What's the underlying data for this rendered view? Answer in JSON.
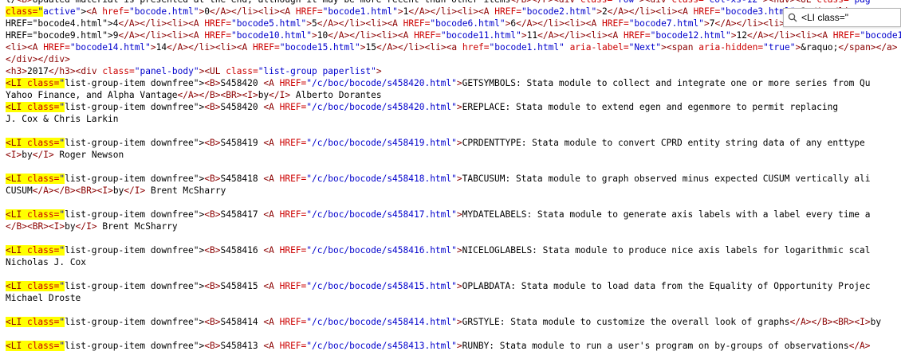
{
  "find_bar": {
    "value": "<LI class=\"",
    "highlight_color": "#ffff00"
  },
  "colors": {
    "tag": "#8b0000",
    "attribute": "#cc0000",
    "value": "#0000cc",
    "highlight": "#ffff00"
  },
  "source_lines": [
    "l/<B>Updated material is presented at the end, although it may be more recent than other items</B></P><div class=\"row\"><div class=\"col-xs-12\"><nav><UL class=\"pag",
    "class=\"active\"><A href=\"bocode.html\">0</A></li><li><A HREF=\"bocode1.html\">1</A></li><li><A HREF=\"bocode2.html\">2</A></li><li><A HREF=\"bocode3.html\">3</A></li>",
    "HREF=\"bocode4.html\">4</A></li><li><A HREF=\"bocode5.html\">5</A></li><li><A HREF=\"bocode6.html\">6</A></li><li><A HREF=\"bocode7.html\">7</A></li><li><A HREF=\"bocode8.html\">8",
    "HREF=\"bocode9.html\">9</A></li><li><A HREF=\"bocode10.html\">10</A></li><li><A HREF=\"bocode11.html\">11</A></li><li><A HREF=\"bocode12.html\">12</A></li><li><A HREF=\"bocode13",
    "<li><A HREF=\"bocode14.html\">14</A></li><li><A HREF=\"bocode15.html\">15</A></li><li><a href=\"bocode1.html\" aria-label=\"Next\"><span aria-hidden=\"true\">&raquo;</span></a>",
    "</div></div>",
    "<h3>2017</h3><div class=\"panel-body\"><UL class=\"list-group paperlist\">",
    "<LI class=\"list-group-item downfree\"><B>S458420 <A HREF=\"/c/boc/bocode/s458420.html\">GETSYMBOLS: Stata module to collect and integrate one or more series from Qu",
    "Yahoo Finance, and Alpha Vantage</A></B><BR><I>by</I> Alberto Dorantes",
    "<LI class=\"list-group-item downfree\"><B>S458420 <A HREF=\"/c/boc/bocode/s458420.html\">EREPLACE: Stata module to extend egen and egenmore to permit replacing",
    "J. Cox & Chris Larkin",
    "",
    "<LI class=\"list-group-item downfree\"><B>S458419 <A HREF=\"/c/boc/bocode/s458419.html\">CPRDENTTYPE: Stata module to convert CPRD entity string data of any enttype",
    "<I>by</I> Roger Newson",
    "",
    "<LI class=\"list-group-item downfree\"><B>S458418 <A HREF=\"/c/boc/bocode/s458418.html\">TABCUSUM: Stata module to graph observed minus expected CUSUM vertically ali",
    "CUSUM</A></B><BR><I>by</I> Brent McSharry",
    "",
    "<LI class=\"list-group-item downfree\"><B>S458417 <A HREF=\"/c/boc/bocode/s458417.html\">MYDATELABELS: Stata module to generate axis labels with a label every time a",
    "</B><BR><I>by</I> Brent McSharry",
    "",
    "<LI class=\"list-group-item downfree\"><B>S458416 <A HREF=\"/c/boc/bocode/s458416.html\">NICELOGLABELS: Stata module to produce nice axis labels for logarithmic scal",
    "Nicholas J. Cox",
    "",
    "<LI class=\"list-group-item downfree\"><B>S458415 <A HREF=\"/c/boc/bocode/s458415.html\">OPLABDATA: Stata module to load data from the Equality of Opportunity Projec",
    "Michael Droste",
    "",
    "<LI class=\"list-group-item downfree\"><B>S458414 <A HREF=\"/c/boc/bocode/s458414.html\">GRSTYLE: Stata module to customize the overall look of graphs</A></B><BR><I>by",
    "",
    "<LI class=\"list-group-item downfree\"><B>S458413 <A HREF=\"/c/boc/bocode/s458413.html\">RUNBY: Stata module to run a user's program on by-groups of observations</A>"
  ]
}
